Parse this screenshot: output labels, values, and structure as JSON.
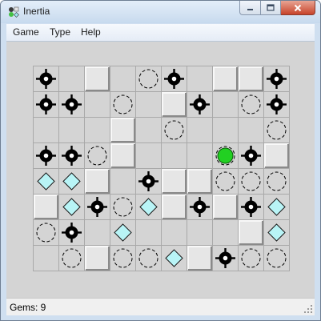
{
  "window": {
    "title": "Inertia"
  },
  "menu": [
    "Game",
    "Type",
    "Help"
  ],
  "status": {
    "gems_text": "Gems: 9"
  },
  "board": {
    "cols": 10,
    "rows": 8,
    "legend": {
      "M": "mine",
      "W": "wall",
      "S": "stop",
      "G": "gem",
      "P": "player",
      ".": "empty"
    },
    "grid": [
      "M.W.SM.WWM",
      "MM.S.WM.SM",
      "...W.S...S",
      "MMSW...PMW",
      "GGW.MWWSSS",
      "WGMSGWMWMG",
      "SM.G....WGG",
      ".SWSSGWMSS"
    ]
  },
  "colors": {
    "background": "#d4d4d4",
    "grid_line": "#a9a9a9",
    "gem": "#b8f4f6",
    "player": "#22d022",
    "mine": "#000000"
  }
}
